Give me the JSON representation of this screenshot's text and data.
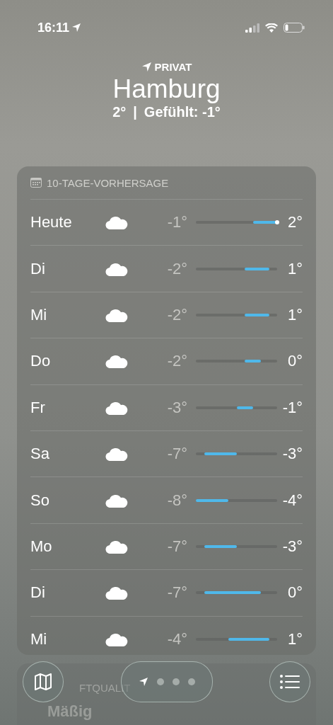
{
  "status_bar": {
    "time": "16:11"
  },
  "header": {
    "label": "PRIVAT",
    "city": "Hamburg",
    "temp": "2°",
    "separator": "|",
    "feels": "Gefühlt: -1°"
  },
  "forecast": {
    "title": "10-TAGE-VORHERSAGE",
    "days": [
      {
        "day": "Heute",
        "low": "-1°",
        "high": "2°",
        "current": true
      },
      {
        "day": "Di",
        "low": "-2°",
        "high": "1°",
        "current": false
      },
      {
        "day": "Mi",
        "low": "-2°",
        "high": "1°",
        "current": false
      },
      {
        "day": "Do",
        "low": "-2°",
        "high": "0°",
        "current": false
      },
      {
        "day": "Fr",
        "low": "-3°",
        "high": "-1°",
        "current": false
      },
      {
        "day": "Sa",
        "low": "-7°",
        "high": "-3°",
        "current": false
      },
      {
        "day": "So",
        "low": "-8°",
        "high": "-4°",
        "current": false
      },
      {
        "day": "Mo",
        "low": "-7°",
        "high": "-3°",
        "current": false
      },
      {
        "day": "Di",
        "low": "-7°",
        "high": "0°",
        "current": false
      },
      {
        "day": "Mi",
        "low": "-4°",
        "high": "1°",
        "current": false
      }
    ]
  },
  "air_quality": {
    "title": "FTQUALIT",
    "value": "Mäßig"
  }
}
